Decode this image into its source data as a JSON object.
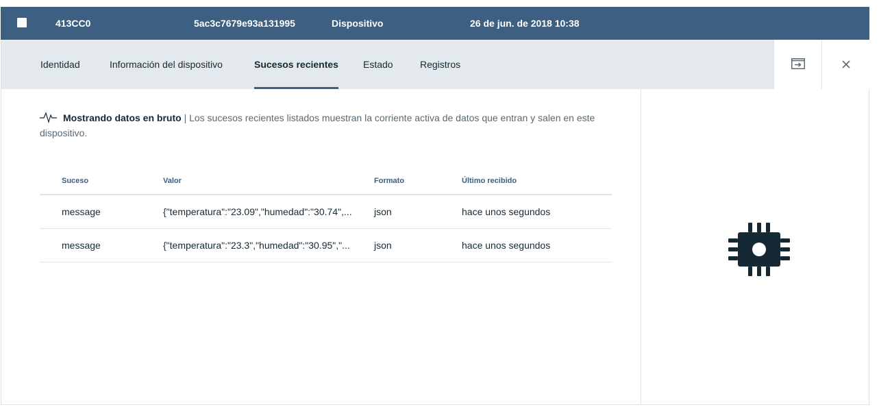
{
  "row": {
    "device_id": "413CC0",
    "identifier": "5ac3c7679e93a131995",
    "type": "Dispositivo",
    "date": "26 de jun. de 2018 10:38"
  },
  "tabs": [
    {
      "label": "Identidad"
    },
    {
      "label": "Información del dispositivo"
    },
    {
      "label": "Sucesos recientes"
    },
    {
      "label": "Estado"
    },
    {
      "label": "Registros"
    }
  ],
  "active_tab": "Sucesos recientes",
  "notice": {
    "icon": "pulse-icon",
    "title": "Mostrando datos en bruto",
    "separator": "|",
    "text": "Los sucesos recientes listados muestran la corriente activa de datos que entran y salen en este dispositivo."
  },
  "table": {
    "headers": [
      "Suceso",
      "Valor",
      "Formato",
      "Último recibido"
    ],
    "rows": [
      {
        "event": "message",
        "value": "{\"temperatura\":\"23.09\",\"humedad\":\"30.74\",...",
        "format": "json",
        "received": "hace unos segundos"
      },
      {
        "event": "message",
        "value": "{\"temperatura\":\"23.3\",\"humedad\":\"30.95\",\"...",
        "format": "json",
        "received": "hace unos segundos"
      }
    ]
  },
  "icons": {
    "expand": "expand-panel-icon",
    "close": "close-icon",
    "device": "chip-icon"
  },
  "colors": {
    "header_bg": "#3d5f81",
    "tabbar_bg": "#e3e9ec",
    "text": "#152935",
    "muted": "#5a6872",
    "chip": "#152935"
  }
}
